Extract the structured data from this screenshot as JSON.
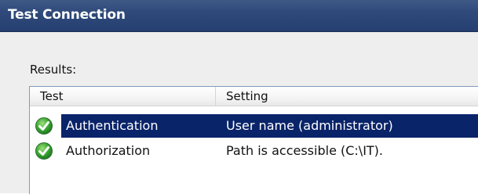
{
  "window": {
    "title": "Test Connection"
  },
  "results": {
    "label": "Results:",
    "columns": [
      "Test",
      "Setting"
    ],
    "rows": [
      {
        "test": "Authentication",
        "setting": "User name (administrator)",
        "status_icon": "success-check-icon",
        "selected": true
      },
      {
        "test": "Authorization",
        "setting": "Path is accessible (C:\\IT).",
        "status_icon": "success-check-icon",
        "selected": false
      }
    ]
  },
  "colors": {
    "titlebar": "#2f4a7a",
    "selection": "#0a246a",
    "success": "#2fa52f"
  }
}
